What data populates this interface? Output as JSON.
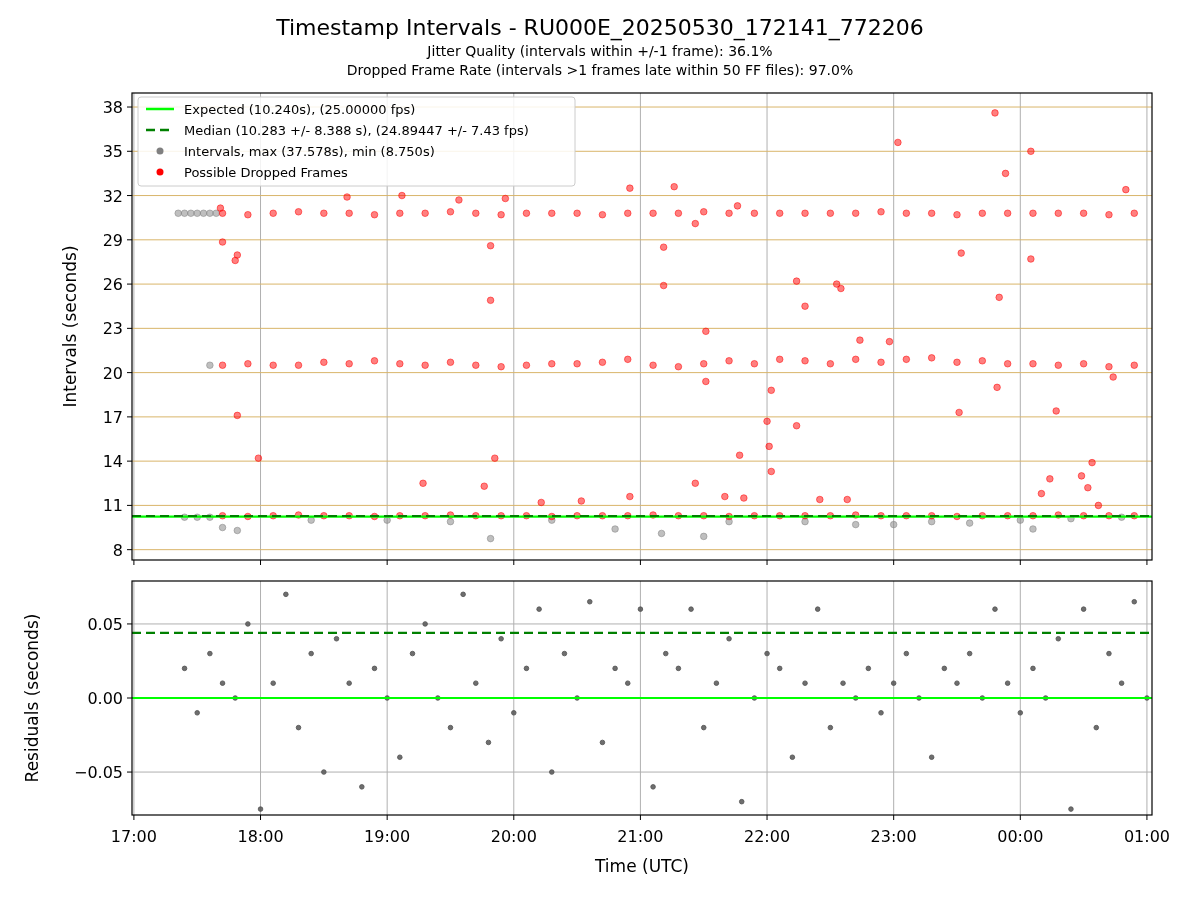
{
  "figure": {
    "title": "Timestamp Intervals - RU000E_20250530_172141_772206",
    "subtitles": [
      "Jitter Quality (intervals within +/-1 frame): 36.1%",
      "Dropped Frame Rate (intervals >1 frames late within 50 FF files): 97.0%"
    ]
  },
  "intervals_panel": {
    "chart_data": {
      "type": "scatter",
      "ylabel": "Intervals (seconds)",
      "xlim": [
        "2025-05-30T16:59:06",
        "2025-05-31T01:02:24"
      ],
      "ylim": [
        7.3,
        38.95
      ],
      "yticks": [
        {
          "value": 8,
          "label": "8"
        },
        {
          "value": 11,
          "label": "11"
        },
        {
          "value": 14,
          "label": "14"
        },
        {
          "value": 17,
          "label": "17"
        },
        {
          "value": 20,
          "label": "20"
        },
        {
          "value": 23,
          "label": "23"
        },
        {
          "value": 26,
          "label": "26"
        },
        {
          "value": 29,
          "label": "29"
        },
        {
          "value": 32,
          "label": "32"
        },
        {
          "value": 35,
          "label": "35"
        },
        {
          "value": 38,
          "label": "38"
        }
      ],
      "ref_lines": [
        {
          "axis": "y",
          "value": 10.24,
          "label": "Expected (10.240s), (25.00000 fps)",
          "color": "#00ff00"
        },
        {
          "axis": "y",
          "value": 10.283,
          "label": "Median (10.283 +/- 8.388 s), (24.89447 +/- 7.43 fps)",
          "color": "#008000"
        }
      ],
      "grid": true,
      "legend": true,
      "series": [
        {
          "name": "Intervals, max (37.578s), min (8.750s)",
          "color": "#808080",
          "x": [
            "2025-05-30T17:21",
            "2025-05-30T17:24",
            "2025-05-30T17:27",
            "2025-05-30T17:30",
            "2025-05-30T17:33",
            "2025-05-30T17:36",
            "2025-05-30T17:39",
            "2025-05-30T17:36",
            "2025-05-30T17:24",
            "2025-05-30T17:30",
            "2025-05-30T17:36",
            "2025-05-30T17:42",
            "2025-05-30T17:49",
            "2025-05-30T18:24",
            "2025-05-30T19:00",
            "2025-05-30T19:30",
            "2025-05-30T19:49",
            "2025-05-30T20:18",
            "2025-05-30T20:48",
            "2025-05-30T21:10",
            "2025-05-30T21:30",
            "2025-05-30T21:42",
            "2025-05-30T22:18",
            "2025-05-30T22:42",
            "2025-05-30T23:00",
            "2025-05-30T23:18",
            "2025-05-30T23:36",
            "2025-05-31T00:00",
            "2025-05-31T00:06",
            "2025-05-31T00:24",
            "2025-05-31T00:48"
          ],
          "values": [
            30.8,
            30.8,
            30.8,
            30.8,
            30.8,
            30.8,
            30.8,
            20.5,
            10.2,
            10.2,
            10.2,
            9.5,
            9.3,
            10.0,
            10.0,
            9.9,
            8.75,
            10.0,
            9.4,
            9.1,
            8.9,
            9.9,
            9.9,
            9.7,
            9.7,
            9.9,
            9.8,
            10.0,
            9.4,
            10.1,
            10.2
          ]
        },
        {
          "name": "Possible Dropped Frames",
          "color": "#ff0000",
          "x": [
            "2025-05-30T17:42",
            "2025-05-30T17:54",
            "2025-05-30T18:06",
            "2025-05-30T18:18",
            "2025-05-30T18:30",
            "2025-05-30T18:42",
            "2025-05-30T18:54",
            "2025-05-30T19:06",
            "2025-05-30T19:18",
            "2025-05-30T19:30",
            "2025-05-30T19:42",
            "2025-05-30T19:54",
            "2025-05-30T20:06",
            "2025-05-30T20:18",
            "2025-05-30T20:30",
            "2025-05-30T20:42",
            "2025-05-30T20:54",
            "2025-05-30T21:06",
            "2025-05-30T21:18",
            "2025-05-30T21:30",
            "2025-05-30T21:42",
            "2025-05-30T21:54",
            "2025-05-30T22:06",
            "2025-05-30T22:18",
            "2025-05-30T22:30",
            "2025-05-30T22:42",
            "2025-05-30T22:54",
            "2025-05-30T23:06",
            "2025-05-30T23:18",
            "2025-05-30T23:30",
            "2025-05-30T23:42",
            "2025-05-30T23:54",
            "2025-05-31T00:06",
            "2025-05-31T00:18",
            "2025-05-31T00:30",
            "2025-05-31T00:42",
            "2025-05-31T00:54",
            "2025-05-30T17:42",
            "2025-05-30T17:54",
            "2025-05-30T18:06",
            "2025-05-30T18:18",
            "2025-05-30T18:30",
            "2025-05-30T18:42",
            "2025-05-30T18:54",
            "2025-05-30T19:06",
            "2025-05-30T19:18",
            "2025-05-30T19:30",
            "2025-05-30T19:42",
            "2025-05-30T19:54",
            "2025-05-30T20:06",
            "2025-05-30T20:18",
            "2025-05-30T20:30",
            "2025-05-30T20:42",
            "2025-05-30T20:54",
            "2025-05-30T21:06",
            "2025-05-30T21:18",
            "2025-05-30T21:30",
            "2025-05-30T21:42",
            "2025-05-30T21:54",
            "2025-05-30T22:06",
            "2025-05-30T22:18",
            "2025-05-30T22:30",
            "2025-05-30T22:42",
            "2025-05-30T22:54",
            "2025-05-30T23:06",
            "2025-05-30T23:18",
            "2025-05-30T23:30",
            "2025-05-30T23:42",
            "2025-05-30T23:54",
            "2025-05-31T00:06",
            "2025-05-31T00:18",
            "2025-05-31T00:30",
            "2025-05-31T00:42",
            "2025-05-31T00:54",
            "2025-05-30T17:42",
            "2025-05-30T17:54",
            "2025-05-30T18:06",
            "2025-05-30T18:18",
            "2025-05-30T18:30",
            "2025-05-30T18:42",
            "2025-05-30T18:54",
            "2025-05-30T19:06",
            "2025-05-30T19:18",
            "2025-05-30T19:30",
            "2025-05-30T19:42",
            "2025-05-30T19:54",
            "2025-05-30T20:06",
            "2025-05-30T20:18",
            "2025-05-30T20:30",
            "2025-05-30T20:42",
            "2025-05-30T20:54",
            "2025-05-30T21:06",
            "2025-05-30T21:18",
            "2025-05-30T21:30",
            "2025-05-30T21:42",
            "2025-05-30T21:54",
            "2025-05-30T22:06",
            "2025-05-30T22:18",
            "2025-05-30T22:30",
            "2025-05-30T22:42",
            "2025-05-30T22:54",
            "2025-05-30T23:06",
            "2025-05-30T23:18",
            "2025-05-30T23:30",
            "2025-05-30T23:42",
            "2025-05-30T23:54",
            "2025-05-31T00:06",
            "2025-05-31T00:18",
            "2025-05-31T00:30",
            "2025-05-31T00:42",
            "2025-05-31T00:54",
            "2025-05-30T17:41",
            "2025-05-30T17:42",
            "2025-05-30T17:49",
            "2025-05-30T17:48",
            "2025-05-30T17:49",
            "2025-05-30T17:59",
            "2025-05-30T18:41",
            "2025-05-30T19:07",
            "2025-05-30T19:34",
            "2025-05-30T19:56",
            "2025-05-30T19:49",
            "2025-05-30T19:49",
            "2025-05-30T19:51",
            "2025-05-30T19:17",
            "2025-05-30T19:46",
            "2025-05-30T20:55",
            "2025-05-30T21:16",
            "2025-05-30T21:11",
            "2025-05-30T21:11",
            "2025-05-30T21:26",
            "2025-05-30T21:31",
            "2025-05-30T21:31",
            "2025-05-30T21:26",
            "2025-05-30T21:46",
            "2025-05-30T21:47",
            "2025-05-30T21:40",
            "2025-05-30T21:49",
            "2025-05-30T22:00",
            "2025-05-30T22:01",
            "2025-05-30T22:02",
            "2025-05-30T22:02",
            "2025-05-30T22:14",
            "2025-05-30T22:18",
            "2025-05-30T22:14",
            "2025-05-30T22:33",
            "2025-05-30T22:35",
            "2025-05-30T22:44",
            "2025-05-30T23:02",
            "2025-05-30T23:32",
            "2025-05-30T23:31",
            "2025-05-30T23:48",
            "2025-05-30T23:53",
            "2025-05-30T23:50",
            "2025-05-30T23:49",
            "2025-05-31T00:05",
            "2025-05-31T00:05",
            "2025-05-31T00:17",
            "2025-05-31T00:50",
            "2025-05-31T00:44",
            "2025-05-31T00:14",
            "2025-05-31T00:10",
            "2025-05-31T00:29",
            "2025-05-31T00:32",
            "2025-05-31T00:34",
            "2025-05-31T00:37",
            "2025-05-30T20:55",
            "2025-05-30T20:13",
            "2025-05-30T20:32",
            "2025-05-30T22:25",
            "2025-05-30T22:38",
            "2025-05-30T22:58"
          ],
          "values": [
            30.8,
            30.7,
            30.8,
            30.9,
            30.8,
            30.8,
            30.7,
            30.8,
            30.8,
            30.9,
            30.8,
            30.7,
            30.8,
            30.8,
            30.8,
            30.7,
            30.8,
            30.8,
            30.8,
            30.9,
            30.8,
            30.8,
            30.8,
            30.8,
            30.8,
            30.8,
            30.9,
            30.8,
            30.8,
            30.7,
            30.8,
            30.8,
            30.8,
            30.8,
            30.8,
            30.7,
            30.8,
            20.5,
            20.6,
            20.5,
            20.5,
            20.7,
            20.6,
            20.8,
            20.6,
            20.5,
            20.7,
            20.5,
            20.4,
            20.5,
            20.6,
            20.6,
            20.7,
            20.9,
            20.5,
            20.4,
            20.6,
            20.8,
            20.6,
            20.9,
            20.8,
            20.6,
            20.9,
            20.7,
            20.9,
            21.0,
            20.7,
            20.8,
            20.6,
            20.6,
            20.5,
            20.6,
            20.4,
            20.5,
            10.3,
            10.25,
            10.3,
            10.35,
            10.3,
            10.3,
            10.25,
            10.3,
            10.3,
            10.35,
            10.3,
            10.3,
            10.3,
            10.25,
            10.3,
            10.3,
            10.3,
            10.35,
            10.3,
            10.3,
            10.25,
            10.3,
            10.3,
            10.3,
            10.3,
            10.35,
            10.3,
            10.3,
            10.3,
            10.25,
            10.3,
            10.3,
            10.3,
            10.35,
            10.3,
            10.3,
            10.3,
            31.15,
            28.85,
            27.97,
            27.6,
            17.1,
            14.2,
            31.9,
            32.0,
            31.7,
            31.8,
            28.6,
            24.9,
            14.2,
            12.5,
            12.3,
            32.5,
            32.6,
            28.5,
            25.9,
            30.1,
            22.8,
            19.4,
            12.5,
            31.3,
            14.4,
            11.6,
            11.5,
            16.7,
            15.0,
            13.3,
            18.8,
            26.2,
            24.5,
            16.4,
            26.0,
            25.7,
            22.2,
            35.6,
            28.1,
            17.3,
            37.6,
            33.5,
            25.1,
            19.0,
            35.0,
            27.7,
            17.4,
            32.4,
            19.7,
            12.8,
            11.8,
            13.0,
            12.2,
            13.9,
            11.0,
            11.6,
            11.2,
            11.3,
            11.4,
            11.4,
            22.1
          ]
        }
      ]
    }
  },
  "residuals_panel": {
    "chart_data": {
      "type": "scatter",
      "xlabel": "Time (UTC)",
      "ylabel": "Residuals (seconds)",
      "xlim": [
        "2025-05-30T16:59:06",
        "2025-05-31T01:02:24"
      ],
      "ylim": [
        -0.079,
        0.079
      ],
      "xticks": [
        {
          "value": "2025-05-30T17:00",
          "label": "17:00"
        },
        {
          "value": "2025-05-30T18:00",
          "label": "18:00"
        },
        {
          "value": "2025-05-30T19:00",
          "label": "19:00"
        },
        {
          "value": "2025-05-30T20:00",
          "label": "20:00"
        },
        {
          "value": "2025-05-30T21:00",
          "label": "21:00"
        },
        {
          "value": "2025-05-30T22:00",
          "label": "22:00"
        },
        {
          "value": "2025-05-30T23:00",
          "label": "23:00"
        },
        {
          "value": "2025-05-31T00:00",
          "label": "00:00"
        },
        {
          "value": "2025-05-31T01:00",
          "label": "01:00"
        }
      ],
      "yticks": [
        {
          "value": -0.05,
          "label": "−0.05"
        },
        {
          "value": 0,
          "label": "0.00"
        },
        {
          "value": 0.05,
          "label": "0.05"
        }
      ],
      "ref_lines": [
        {
          "axis": "y",
          "value": 0.044,
          "color": "#008000"
        },
        {
          "axis": "y",
          "value": 0,
          "color": "#00ff00"
        }
      ],
      "grid": true,
      "series": [
        {
          "color": "#555555",
          "x": [
            "2025-05-30T17:24",
            "2025-05-30T17:30",
            "2025-05-30T17:36",
            "2025-05-30T17:42",
            "2025-05-30T17:48",
            "2025-05-30T17:54",
            "2025-05-30T18:00",
            "2025-05-30T18:06",
            "2025-05-30T18:12",
            "2025-05-30T18:18",
            "2025-05-30T18:24",
            "2025-05-30T18:30",
            "2025-05-30T18:36",
            "2025-05-30T18:42",
            "2025-05-30T18:48",
            "2025-05-30T18:54",
            "2025-05-30T19:00",
            "2025-05-30T19:06",
            "2025-05-30T19:12",
            "2025-05-30T19:18",
            "2025-05-30T19:24",
            "2025-05-30T19:30",
            "2025-05-30T19:36",
            "2025-05-30T19:42",
            "2025-05-30T19:48",
            "2025-05-30T19:54",
            "2025-05-30T20:00",
            "2025-05-30T20:06",
            "2025-05-30T20:12",
            "2025-05-30T20:18",
            "2025-05-30T20:24",
            "2025-05-30T20:30",
            "2025-05-30T20:36",
            "2025-05-30T20:42",
            "2025-05-30T20:48",
            "2025-05-30T20:54",
            "2025-05-30T21:00",
            "2025-05-30T21:06",
            "2025-05-30T21:12",
            "2025-05-30T21:18",
            "2025-05-30T21:24",
            "2025-05-30T21:30",
            "2025-05-30T21:36",
            "2025-05-30T21:42",
            "2025-05-30T21:48",
            "2025-05-30T21:54",
            "2025-05-30T22:00",
            "2025-05-30T22:06",
            "2025-05-30T22:12",
            "2025-05-30T22:18",
            "2025-05-30T22:24",
            "2025-05-30T22:30",
            "2025-05-30T22:36",
            "2025-05-30T22:42",
            "2025-05-30T22:48",
            "2025-05-30T22:54",
            "2025-05-30T23:00",
            "2025-05-30T23:06",
            "2025-05-30T23:12",
            "2025-05-30T23:18",
            "2025-05-30T23:24",
            "2025-05-30T23:30",
            "2025-05-30T23:36",
            "2025-05-30T23:42",
            "2025-05-30T23:48",
            "2025-05-30T23:54",
            "2025-05-31T00:00",
            "2025-05-31T00:06",
            "2025-05-31T00:12",
            "2025-05-31T00:18",
            "2025-05-31T00:24",
            "2025-05-31T00:30",
            "2025-05-31T00:36",
            "2025-05-31T00:42",
            "2025-05-31T00:48",
            "2025-05-31T00:54",
            "2025-05-31T01:00"
          ],
          "values": [
            0.02,
            -0.01,
            0.03,
            0.01,
            0.0,
            0.05,
            -0.075,
            0.01,
            0.07,
            -0.02,
            0.03,
            -0.05,
            0.04,
            0.01,
            -0.06,
            0.02,
            0.0,
            -0.04,
            0.03,
            0.05,
            0.0,
            -0.02,
            0.07,
            0.01,
            -0.03,
            0.04,
            -0.01,
            0.02,
            0.06,
            -0.05,
            0.03,
            0.0,
            0.065,
            -0.03,
            0.02,
            0.01,
            0.06,
            -0.06,
            0.03,
            0.02,
            0.06,
            -0.02,
            0.01,
            0.04,
            -0.07,
            0.0,
            0.03,
            0.02,
            -0.04,
            0.01,
            0.06,
            -0.02,
            0.01,
            0.0,
            0.02,
            -0.01,
            0.01,
            0.03,
            0.0,
            -0.04,
            0.02,
            0.01,
            0.03,
            0.0,
            0.06,
            0.01,
            -0.01,
            0.02,
            0.0,
            0.04,
            -0.075,
            0.06,
            -0.02,
            0.03,
            0.01,
            0.065,
            0.0
          ]
        }
      ]
    }
  }
}
